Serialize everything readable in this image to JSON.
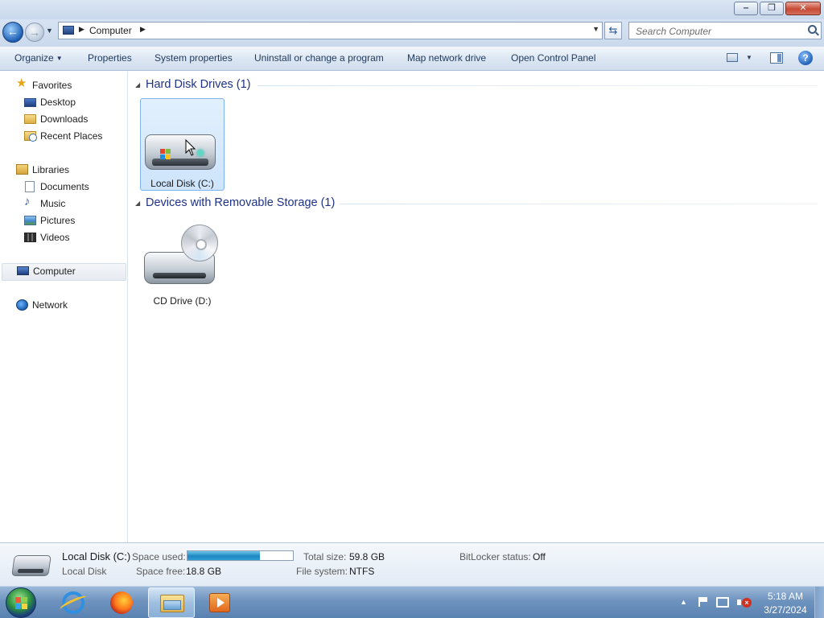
{
  "window": {
    "minimize_glyph": "‒",
    "maximize_glyph": "❐",
    "close_glyph": "✕"
  },
  "address": {
    "back_glyph": "←",
    "forward_glyph": "→",
    "location": "Computer",
    "sep": "▶",
    "refresh_glyph": "⇆"
  },
  "search": {
    "placeholder": "Search Computer"
  },
  "toolbar": {
    "organize": "Organize",
    "properties": "Properties",
    "system_properties": "System properties",
    "uninstall": "Uninstall or change a program",
    "map_drive": "Map network drive",
    "control_panel": "Open Control Panel",
    "help_glyph": "?"
  },
  "sidebar": {
    "favorites": "Favorites",
    "desktop": "Desktop",
    "downloads": "Downloads",
    "recent_places": "Recent Places",
    "libraries": "Libraries",
    "documents": "Documents",
    "music": "Music",
    "pictures": "Pictures",
    "videos": "Videos",
    "computer": "Computer",
    "network": "Network"
  },
  "groups": {
    "hdd_title": "Hard Disk Drives (1)",
    "removable_title": "Devices with Removable Storage (1)"
  },
  "drives": {
    "local_disk": "Local Disk (C:)",
    "cd_drive": "CD Drive (D:)"
  },
  "details": {
    "name": "Local Disk (C:)",
    "type": "Local Disk",
    "space_used_label": "Space used:",
    "space_free_label": "Space free:",
    "space_free": "18.8 GB",
    "total_size_label": "Total size:",
    "total_size": "59.8 GB",
    "file_system_label": "File system:",
    "file_system": "NTFS",
    "bitlocker_label": "BitLocker status:",
    "bitlocker": "Off",
    "space_used_fraction": 0.69
  },
  "taskbar": {
    "tray_up_glyph": "▲",
    "volume_muted_glyph": "×",
    "time": "5:18 AM",
    "date": "3/27/2024"
  },
  "colors": {
    "group_title": "#1e3287",
    "usage_fill": "#1d86bf",
    "selection": "#cde4fb"
  }
}
